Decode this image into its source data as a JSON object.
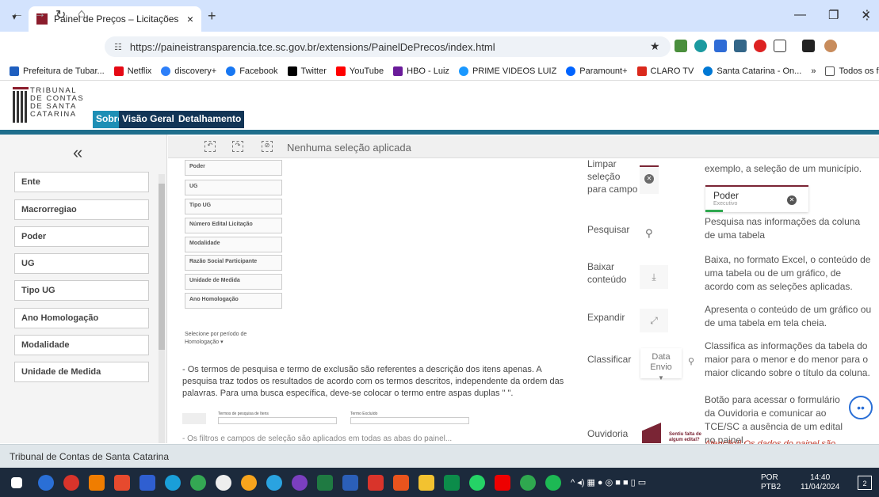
{
  "browser": {
    "tab_title": "Painel de Preços – Licitações",
    "tab_close": "×",
    "new_tab": "+",
    "url": "https://paineistransparencia.tce.sc.gov.br/extensions/PainelDePrecos/index.html",
    "bookmarks": [
      "Prefeitura de Tubar...",
      "Netflix",
      "discovery+",
      "Facebook",
      "Twitter",
      "YouTube",
      "HBO - Luiz",
      "PRIME VIDEOS LUIZ",
      "Paramount+",
      "CLARO TV",
      "Santa Catarina - On...",
      "»",
      "Todos os favoritos"
    ]
  },
  "header": {
    "logo_lines": [
      "TRIBUNAL",
      "DE CONTAS",
      "DE SANTA",
      "CATARINA"
    ],
    "tabs": [
      "Sobre",
      "Visão Geral",
      "Detalhamento"
    ]
  },
  "sidebar": {
    "collapse_icon": "«",
    "filters": [
      "Ente",
      "Macrorregiao",
      "Poder",
      "UG",
      "Tipo UG",
      "Ano Homologação",
      "Modalidade",
      "Unidade de Medida"
    ]
  },
  "toolbar": {
    "selection_status": "Nenhuma seleção aplicada"
  },
  "content": {
    "mini_fields": [
      "Poder",
      "UG",
      "Tipo UG",
      "Número Edital Licitação",
      "Modalidade",
      "Razão Social Participante",
      "Unidade de Medida",
      "Ano Homologação"
    ],
    "period_label": "Selecione por período de Homologação ▾",
    "description": "- Os termos de pesquisa e termo de exclusão são referentes a descrição dos itens apenas. A pesquisa traz todos os resultados de acordo com os termos descritos, independente da ordem das palavras. Para uma busca específica, deve-se colocar o termo entre aspas duplas \" \".",
    "mini_search_labels": [
      "Termos de pesquisa de Itens",
      "Termo Excluído"
    ],
    "cut_line": "- Os filtros e campos de seleção são aplicados em todas as abas do painel..."
  },
  "help": [
    {
      "label": "Limpar seleção para campo",
      "desc": "exemplo, a seleção de um município."
    },
    {
      "label": "Pesquisar",
      "desc": "Pesquisa nas informações da coluna de uma tabela"
    },
    {
      "label": "Baixar conteúdo",
      "desc": "Baixa, no formato Excel, o conteúdo de uma tabela ou de um gráfico, de acordo com as seleções aplicadas."
    },
    {
      "label": "Expandir",
      "desc": "Apresenta o conteúdo de um gráfico ou de uma tabela em tela cheia."
    },
    {
      "label": "Classificar",
      "desc": "Classifica as informações da tabela do maior para o menor e do menor para o maior clicando sobre o título da coluna."
    },
    {
      "label": "Ouvidoria",
      "desc": "Botão para acessar o formulário da Ouvidoria e comunicar ao TCE/SC a ausência de um edital no painel."
    }
  ],
  "poder_card": {
    "title": "Poder",
    "subtitle": "Executivo"
  },
  "sort_box": {
    "line1": "Data",
    "line2": "Envio"
  },
  "ouvidoria_note": "Sentiu falta de algum edital?",
  "ouvidoria_warning": "Atenção!! Os dados do painel são",
  "footer": "Tribunal de Contas de Santa Catarina",
  "taskbar": {
    "lang1": "POR",
    "lang2": "PTB2",
    "time": "14:40",
    "date": "11/04/2024",
    "notif": "2"
  },
  "colors": {
    "accent": "#1f6e8c",
    "navy": "#123556",
    "tab_active": "#1e8fb5",
    "wine": "#7a2535"
  }
}
